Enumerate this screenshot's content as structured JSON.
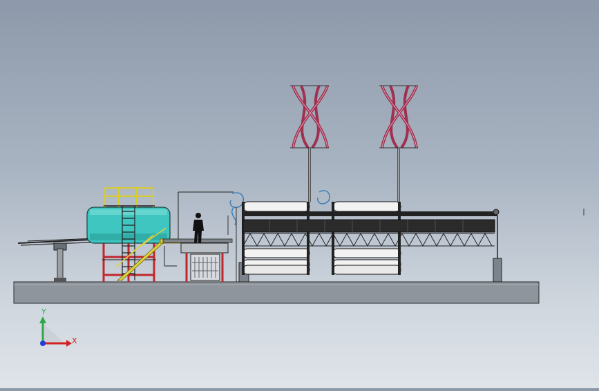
{
  "viewport": {
    "background_top": "#8d99aa",
    "background_bottom": "#dfe4e9"
  },
  "triad": {
    "y_label": "Y",
    "x_label": "X",
    "y_color": "#2ea84a",
    "x_color": "#d32020",
    "z_color": "#1f3fd6"
  },
  "colors": {
    "tank": "#3fc6c0",
    "frame_red": "#c0272d",
    "stair_yellow": "#e0d23a",
    "turbine_magenta": "#a0304f",
    "base_slab": "#8f959c",
    "pipe_blue": "#3c7fb5"
  }
}
